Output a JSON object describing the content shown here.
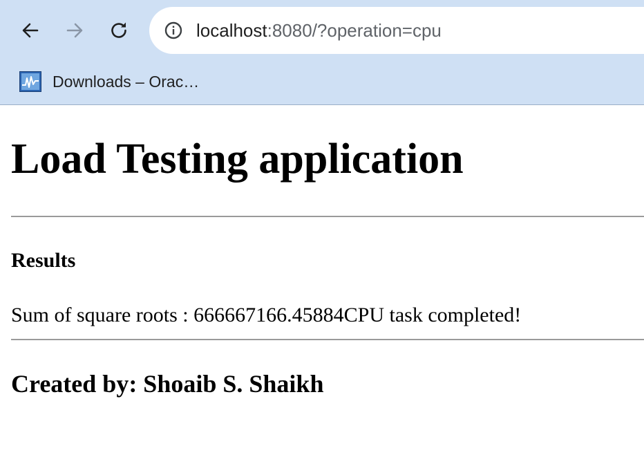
{
  "browser": {
    "url_host": "localhost",
    "url_rest": ":8080/?operation=cpu",
    "bookmarks": [
      {
        "label": "Downloads – Orac…",
        "icon": "oracle-monitor-favicon-icon"
      }
    ],
    "icons": {
      "back": "arrow-left-icon",
      "forward": "arrow-right-icon",
      "reload": "reload-icon",
      "site_info": "info-icon"
    },
    "colors": {
      "chrome_background": "#cfe0f4",
      "omnibox_background": "#ffffff",
      "favicon_blue": "#2a63b0"
    }
  },
  "page": {
    "title": "Load Testing application",
    "results_heading": "Results",
    "result_text": "Sum of square roots : 666667166.45884CPU task completed!",
    "credit": "Created by: Shoaib S. Shaikh"
  }
}
